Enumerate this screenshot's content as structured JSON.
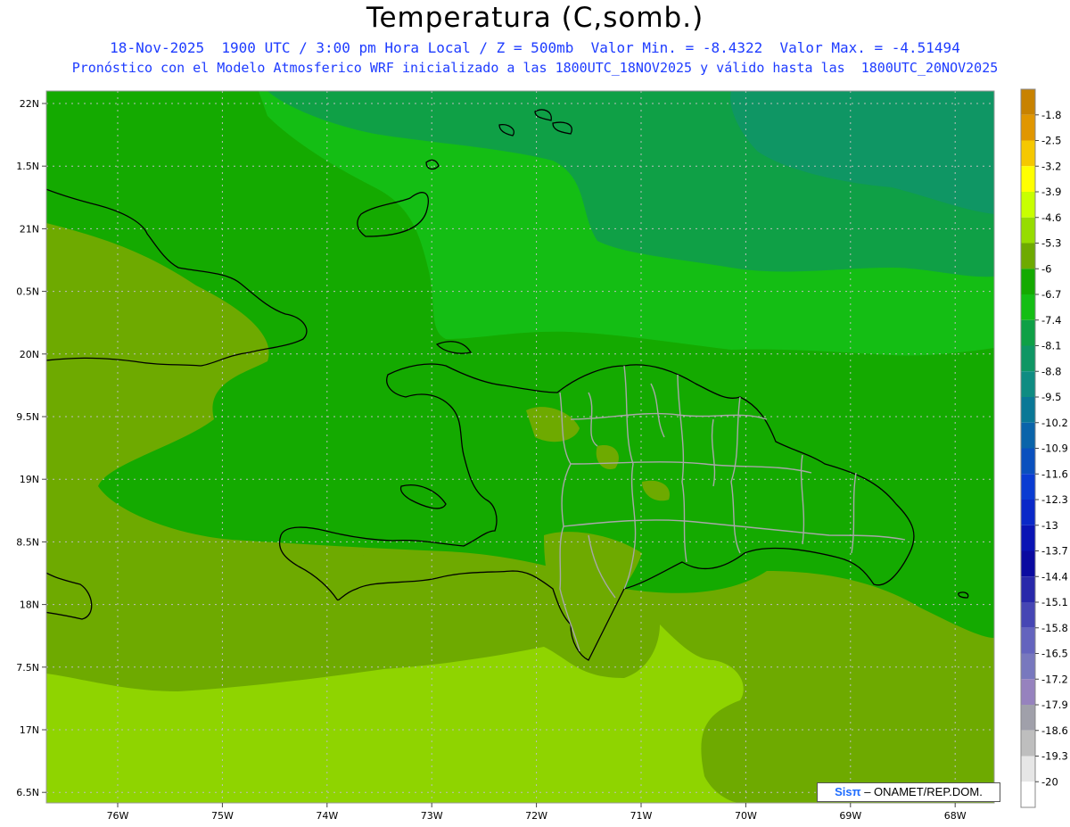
{
  "header": {
    "title": "Temperatura (C,somb.)",
    "line1": "18-Nov-2025  1900 UTC / 3:00 pm Hora Local / Z = 500mb  Valor Min. = -8.4322  Valor Max. = -4.51494",
    "line2": "Pronóstico con el Modelo Atmosferico WRF inicializado a las 1800UTC_18NOV2025 y válido hasta las  1800UTC_20NOV2025"
  },
  "map": {
    "lat_labels": [
      "22N",
      "1.5N",
      "21N",
      "0.5N",
      "20N",
      "9.5N",
      "19N",
      "8.5N",
      "18N",
      "7.5N",
      "17N",
      "6.5N"
    ],
    "lon_labels": [
      "76W",
      "75W",
      "74W",
      "73W",
      "72W",
      "71W",
      "70W",
      "69W",
      "68W"
    ]
  },
  "colorbar": {
    "labels": [
      "-1.8",
      "-2.5",
      "-3.2",
      "-3.9",
      "-4.6",
      "-5.3",
      "-6",
      "-6.7",
      "-7.4",
      "-8.1",
      "-8.8",
      "-9.5",
      "-10.2",
      "-10.9",
      "-11.6",
      "-12.3",
      "-13",
      "-13.7",
      "-14.4",
      "-15.1",
      "-15.8",
      "-16.5",
      "-17.2",
      "-17.9",
      "-18.6",
      "-19.3",
      "-20"
    ],
    "colors": [
      "#c88200",
      "#e09600",
      "#f5c800",
      "#ffff00",
      "#c8ff00",
      "#96dc00",
      "#6eaa00",
      "#14aa00",
      "#14be14",
      "#0fa046",
      "#0f9664",
      "#0f8c82",
      "#0a7896",
      "#0a64aa",
      "#0a50be",
      "#0a3cd2",
      "#0a28c8",
      "#0a14b4",
      "#0a0aa0",
      "#2828aa",
      "#4646b4",
      "#6464be",
      "#7878be",
      "#9682be",
      "#a0a0aa",
      "#bebebe",
      "#e6e6e6",
      "#ffffff"
    ]
  },
  "credit": {
    "brand": "Sisπ",
    "text": " – ONAMET/REP.DOM."
  }
}
